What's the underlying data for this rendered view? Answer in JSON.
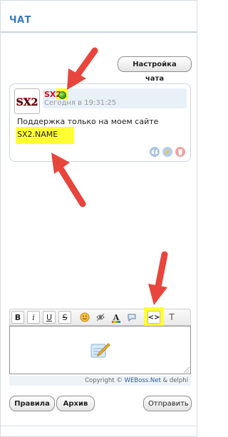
{
  "chat": {
    "title": "ЧАТ",
    "settings_label": "Настройка чата"
  },
  "message": {
    "avatar_text": "SX2",
    "author": "SX2",
    "status": "online",
    "timestamp": "Сегодня в 19:31:25",
    "text": "Поддержка только на моем сайте",
    "link": "SX2.NAME",
    "actions": [
      "quote-icon",
      "edit-icon",
      "delete-icon"
    ]
  },
  "toolbar": {
    "buttons": [
      {
        "name": "bold-button",
        "label": "B"
      },
      {
        "name": "italic-button",
        "label": "i"
      },
      {
        "name": "underline-button",
        "label": "U"
      },
      {
        "name": "strike-button",
        "label": "S"
      },
      {
        "name": "smiley-button",
        "icon": "smiley-icon"
      },
      {
        "name": "spoiler-button",
        "icon": "spoiler-icon"
      },
      {
        "name": "color-button",
        "label": "A"
      },
      {
        "name": "quote-button",
        "icon": "speech-bubble-icon"
      },
      {
        "name": "code-button",
        "label": "<>"
      },
      {
        "name": "translit-button",
        "label": "T"
      }
    ]
  },
  "footer": {
    "copyright_prefix": "Copyright ©",
    "copyright_brand": "WEBoss.Net",
    "copyright_suffix": "& delphi",
    "rules_label": "Правила",
    "archive_label": "Архив",
    "send_label": "Отправить"
  },
  "colors": {
    "title": "#3a78c0",
    "author": "#c4121c",
    "highlight": "#ffff33",
    "arrow": "#e8453c"
  }
}
